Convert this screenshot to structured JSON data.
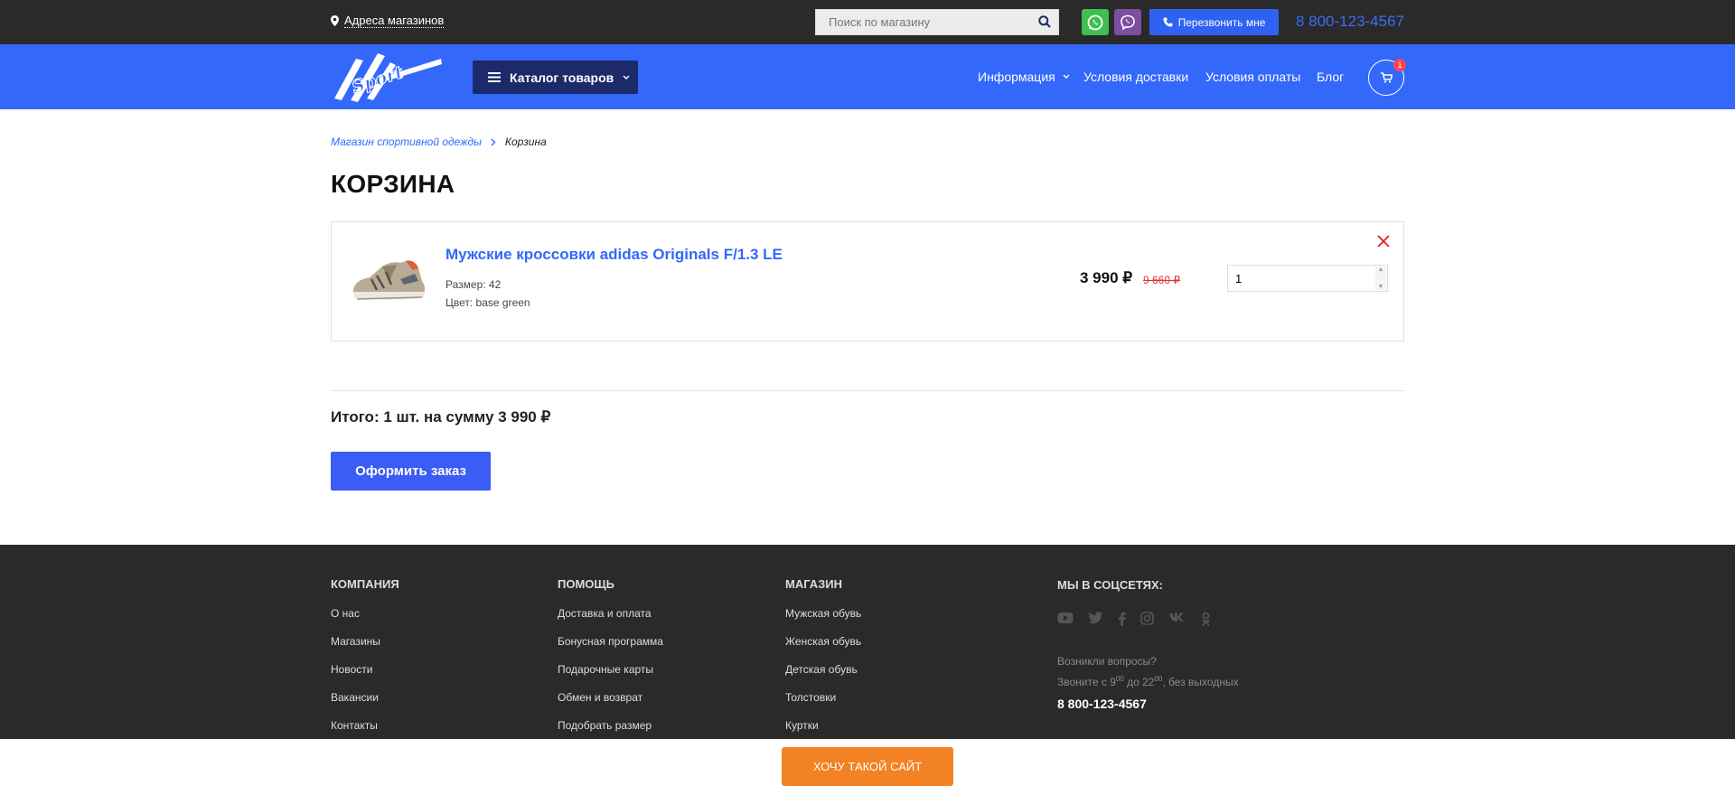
{
  "topbar": {
    "address_link": "Адреса магазинов",
    "search_placeholder": "Поиск по магазину",
    "callback_label": "Перезвонить мне",
    "phone": "8 800-123-4567"
  },
  "header": {
    "catalog_label": "Каталог товаров",
    "nav": [
      "Информация",
      "Условия доставки",
      "Условия оплаты",
      "Блог"
    ],
    "cart_count": "1"
  },
  "breadcrumb": [
    "Магазин спортивной одежды",
    "Корзина"
  ],
  "page_title": "КОРЗИНА",
  "cart_item": {
    "name": "Мужские кроссовки adidas Originals F/1.3 LE",
    "size": "Размер: 42",
    "color": "Цвет: base green",
    "price": "3 990 ₽",
    "old_price": "9 660 ₽",
    "quantity": "1"
  },
  "summary": {
    "total": "Итого: 1 шт. на сумму 3 990 ₽",
    "order_button": "Оформить заказ"
  },
  "footer": {
    "company": {
      "title": "КОМПАНИЯ",
      "links": [
        "О нас",
        "Магазины",
        "Новости",
        "Вакансии",
        "Контакты"
      ]
    },
    "help": {
      "title": "ПОМОЩЬ",
      "links": [
        "Доставка и оплата",
        "Бонусная программа",
        "Подарочные карты",
        "Обмен и возврат",
        "Подобрать размер"
      ]
    },
    "shop": {
      "title": "МАГАЗИН",
      "links": [
        "Мужская обувь",
        "Женская обувь",
        "Детская обувь",
        "Толстовки",
        "Куртки"
      ]
    },
    "social": {
      "title": "МЫ В СОЦСЕТЯХ:",
      "icons": [
        "youtube-icon",
        "twitter-icon",
        "facebook-icon",
        "instagram-icon",
        "vk-icon",
        "odnoklassniki-icon"
      ],
      "question": "Возникли вопросы?",
      "hours_prefix": "Звоните с 9",
      "hours_from_sup": "00",
      "hours_mid": " до 22",
      "hours_to_sup": "00",
      "hours_suffix": ", без выходных",
      "phone": "8 800-123-4567"
    }
  },
  "promo_button": "ХОЧУ ТАКОЙ САЙТ",
  "colors": {
    "brand_blue": "#3468fb",
    "dark": "#2a2a2a",
    "promo_orange": "#f28224"
  }
}
